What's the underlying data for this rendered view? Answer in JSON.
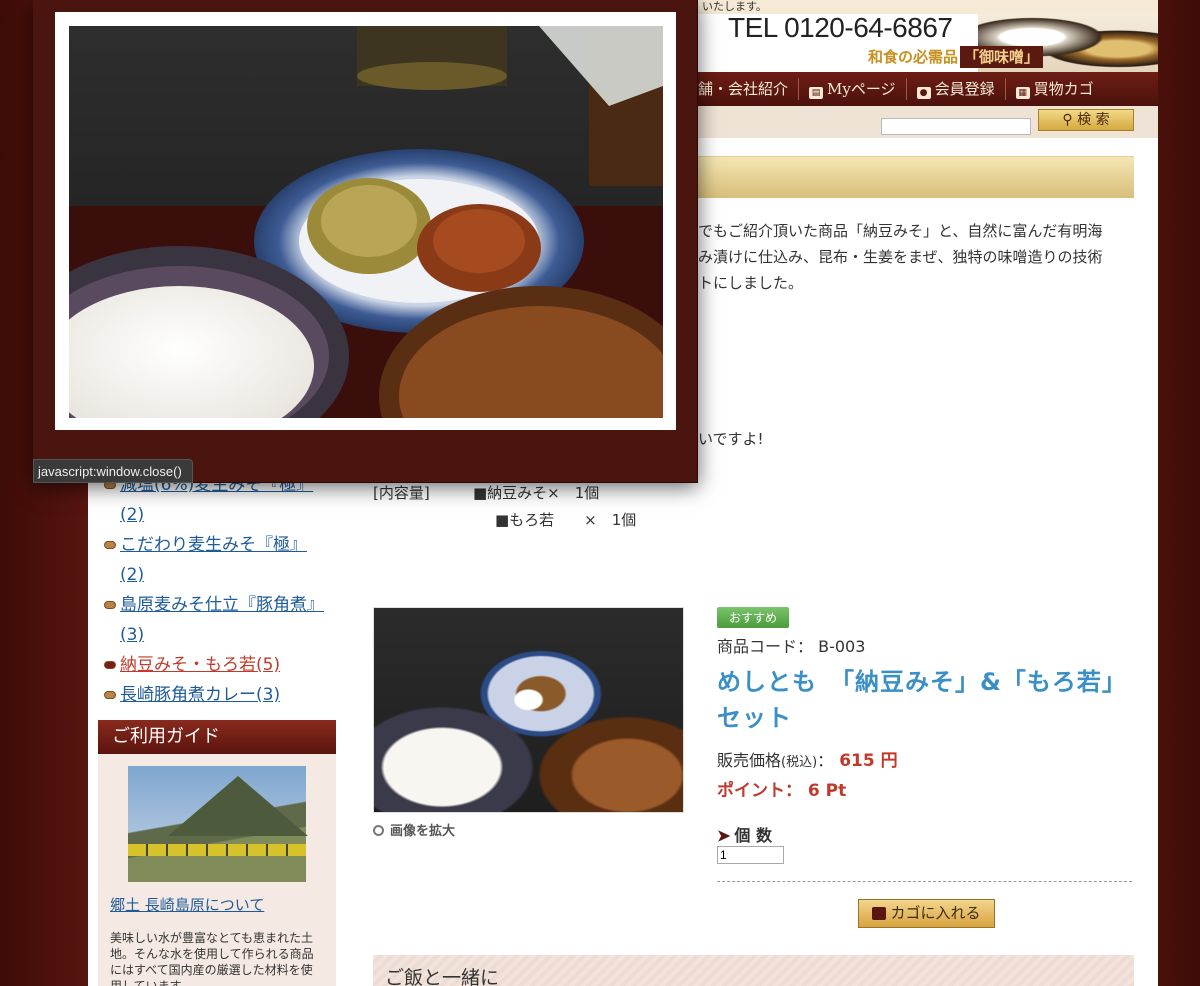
{
  "header": {
    "notice": "いたします。",
    "tel": "TEL 0120-64-6867",
    "tagline": "和食の必需品",
    "tagline_box": "「御味噌」"
  },
  "nav": [
    {
      "label": "舗・会社紹介",
      "icon": ""
    },
    {
      "label": "Myページ",
      "icon": "my-page-icon"
    },
    {
      "label": "会員登録",
      "icon": "member-icon"
    },
    {
      "label": "買物カゴ",
      "icon": "cart-icon"
    }
  ],
  "search": {
    "button": "検 索",
    "value": ""
  },
  "intro": {
    "lines": [
      "でもご紹介頂いた商品「納豆みそ」と、自然に富んだ有明海",
      "み漬けに仕込み、昆布・生姜をまぜ、独特の味噌造りの技術",
      "トにしました。"
    ],
    "tail": "いですよ!"
  },
  "contents": {
    "label": "[内容量]",
    "items": [
      "■納豆みそ×　1個",
      "■もろ若　　×　1個"
    ]
  },
  "sidebar": {
    "categories": [
      {
        "label": "減塩(6%)麦生みそ『極』(2)",
        "active": false
      },
      {
        "label": "こだわり麦生みそ『極』(2)",
        "active": false
      },
      {
        "label": "島原麦みそ仕立『豚角煮』(3)",
        "active": false
      },
      {
        "label": "納豆みそ・もろ若(5)",
        "active": true
      },
      {
        "label": "長崎豚角煮カレー(3)",
        "active": false
      }
    ],
    "guide": {
      "title": "ご利用ガイド",
      "link": "郷土 長崎島原について",
      "text": "美味しい水が豊富なとても恵まれた土地。そんな水を使用して作られる商品にはすべて国内産の厳選した材料を使用しています。"
    }
  },
  "product": {
    "badge": "おすすめ",
    "code_label": "商品コード：",
    "code": "B-003",
    "name": "めしとも　「納豆みそ」&「もろ若」セット",
    "price_label": "販売価格",
    "price_tax": "(税込)",
    "price_sep": "：",
    "price": "615 円",
    "point": "ポイント： 6 Pt",
    "zoom": "画像を拡大",
    "qty_label": "個 数",
    "qty_value": "1",
    "cart_button": "カゴに入れる"
  },
  "related": {
    "title": "ご飯と一緒に"
  },
  "popup": {
    "status": "javascript:window.close()"
  },
  "colors": {
    "maroon": "#5a1610",
    "link": "#1f5b9a",
    "accent_blue": "#3a8fc7",
    "price_red": "#c0392b"
  }
}
